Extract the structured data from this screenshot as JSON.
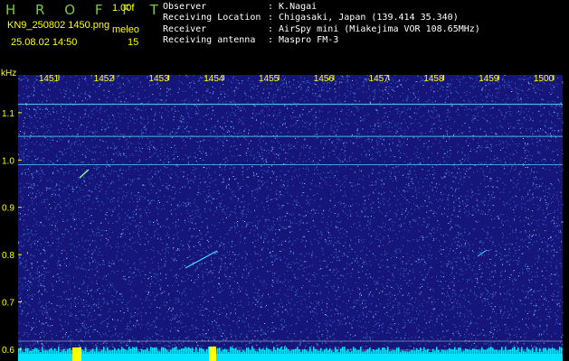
{
  "header": {
    "app_name": "H R O F F T",
    "version": "1.00f",
    "filename": "KN9_250802 1450.png",
    "mode": "meleo",
    "datetime": "25.08.02 14:50",
    "count": "15"
  },
  "info": [
    {
      "label": "Observer",
      "value": ": K.Nagai"
    },
    {
      "label": "Receiving Location",
      "value": ": Chigasaki, Japan (139.414 35.340)"
    },
    {
      "label": "Receiver",
      "value": ": AirSpy mini (Miakejima VOR 108.65MHz)"
    },
    {
      "label": "Receiving antenna",
      "value": ": Maspro FM-3"
    }
  ],
  "chart_data": {
    "type": "heatmap",
    "ylabel": "kHz",
    "x_ticks": [
      "1451",
      "1452",
      "1453",
      "1454",
      "1455",
      "1456",
      "1457",
      "1458",
      "1459",
      "1500"
    ],
    "y_ticks": [
      "1.1",
      "1.0",
      "0.9",
      "0.8",
      "0.7",
      "0.6"
    ],
    "ylim": [
      0.575,
      1.18
    ],
    "horizontal_lines_khz": [
      1.118,
      1.05,
      0.99,
      0.617,
      0.598
    ],
    "colors": {
      "background": "#16167a",
      "noise": "#3b6bd6",
      "noise_bright": "#9fd0ff",
      "signal": "#40e0ff",
      "baseline": "#00e5ff",
      "marker": "#ffff00",
      "axis_text": "#ffff00"
    }
  }
}
